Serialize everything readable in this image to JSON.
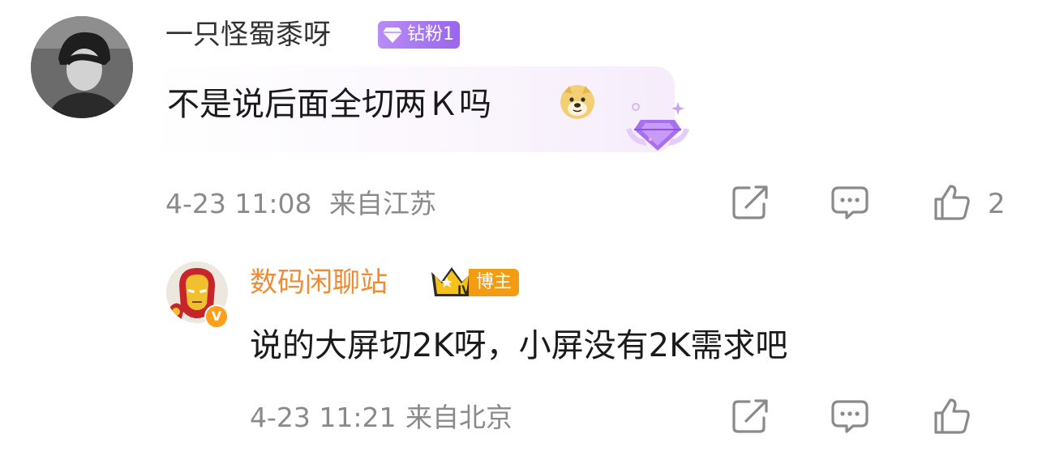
{
  "comment": {
    "username": "一只怪蜀黍呀",
    "fan_badge": "钻粉1",
    "text": "不是说后面全切两Ｋ吗",
    "emoji_icon": "doge-emoji-icon",
    "time": "4-23 11:08",
    "location": "来自江苏",
    "like_count": "2"
  },
  "reply": {
    "username": "数码闲聊站",
    "verified_mark": "V",
    "role_badge": "博主",
    "crown_level": "IV",
    "text": "说的大屏切2K呀，小屏没有2K需求吧",
    "time": "4-23 11:21",
    "location": "来自北京"
  },
  "colors": {
    "meta_gray": "#8a8a8a",
    "author_orange": "#ef8c33",
    "fan_badge_purple": "#9a66ee",
    "host_badge_orange": "#f39c12"
  }
}
